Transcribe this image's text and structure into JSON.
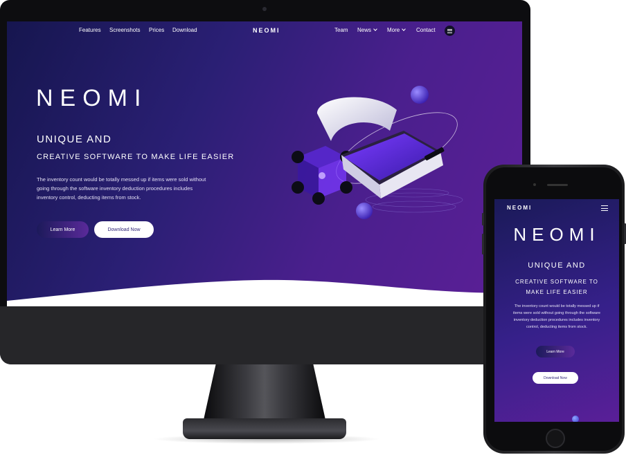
{
  "desktop": {
    "nav": {
      "features": "Features",
      "screenshots": "Screenshots",
      "prices": "Prices",
      "download": "Download",
      "logo": "NEOMI",
      "team": "Team",
      "news": "News",
      "more": "More",
      "contact": "Contact"
    },
    "hero": {
      "logo": "NEOMI",
      "heading": "UNIQUE AND",
      "subheading": "CREATIVE SOFTWARE TO MAKE LIFE EASIER",
      "paragraph": "The inventory count would be totally messed up if items were sold without going through the software inventory deduction procedures includes inventory control, deducting items from stock.",
      "learn_more": "Learn More",
      "download_now": "Download Now"
    }
  },
  "mobile": {
    "logo_small": "NEOMI",
    "logo": "NEOMI",
    "heading": "UNIQUE AND",
    "subheading": "CREATIVE SOFTWARE TO MAKE LIFE EASIER",
    "paragraph": "The inventory count would be totally messed up if items were sold without going through the software inventory deduction procedures includes inventory control, deducting items from stock.",
    "learn_more": "Learn More",
    "download_now": "Download Now"
  },
  "colors": {
    "accent_dark": "#2a1f74",
    "accent_purple": "#5c1f97",
    "button_white": "#ffffff"
  },
  "icons": {
    "menu": "hamburger-menu-icon",
    "dropdown": "chevron-down-icon"
  }
}
